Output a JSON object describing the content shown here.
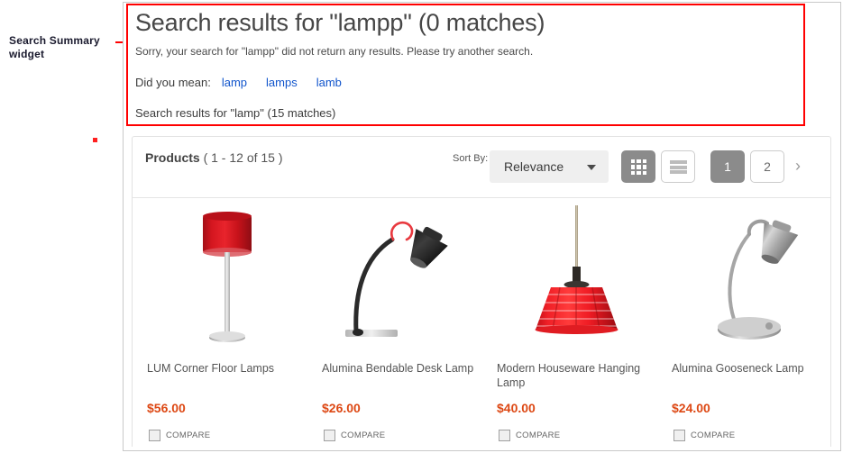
{
  "annotation": {
    "label": "Search Summary widget"
  },
  "search_summary": {
    "title": "Search results for \"lampp\" (0 matches)",
    "no_results_text": "Sorry, your search for \"lampp\" did not return any results. Please try another search.",
    "did_you_mean_label": "Did you mean:",
    "suggestions": [
      "lamp",
      "lamps",
      "lamb"
    ],
    "fallback_results_text": "Search results for \"lamp\" (15 matches)"
  },
  "toolbar": {
    "products_label": "Products",
    "products_count": "(  1 - 12 of 15  )",
    "sort_by_label": "Sort By:",
    "sort_selected": "Relevance",
    "grid_view_icon": "grid-view-icon",
    "list_view_icon": "list-view-icon",
    "pagination": {
      "page_1": "1",
      "page_2": "2",
      "next_icon": "›"
    }
  },
  "products": [
    {
      "name": "LUM Corner Floor Lamps",
      "price": "$56.00",
      "compare_label": "COMPARE",
      "image": "red-floor-lamp"
    },
    {
      "name": "Alumina Bendable Desk Lamp",
      "price": "$26.00",
      "compare_label": "COMPARE",
      "image": "black-desk-lamp"
    },
    {
      "name": "Modern Houseware Hanging Lamp",
      "price": "$40.00",
      "compare_label": "COMPARE",
      "image": "red-pendant-lamp"
    },
    {
      "name": "Alumina Gooseneck Lamp",
      "price": "$24.00",
      "compare_label": "COMPARE",
      "image": "silver-gooseneck-lamp"
    }
  ],
  "colors": {
    "annotation_red": "#ff0000",
    "price_orange": "#dd4814",
    "link_blue": "#1155cc",
    "active_gray": "#8b8b8b"
  }
}
